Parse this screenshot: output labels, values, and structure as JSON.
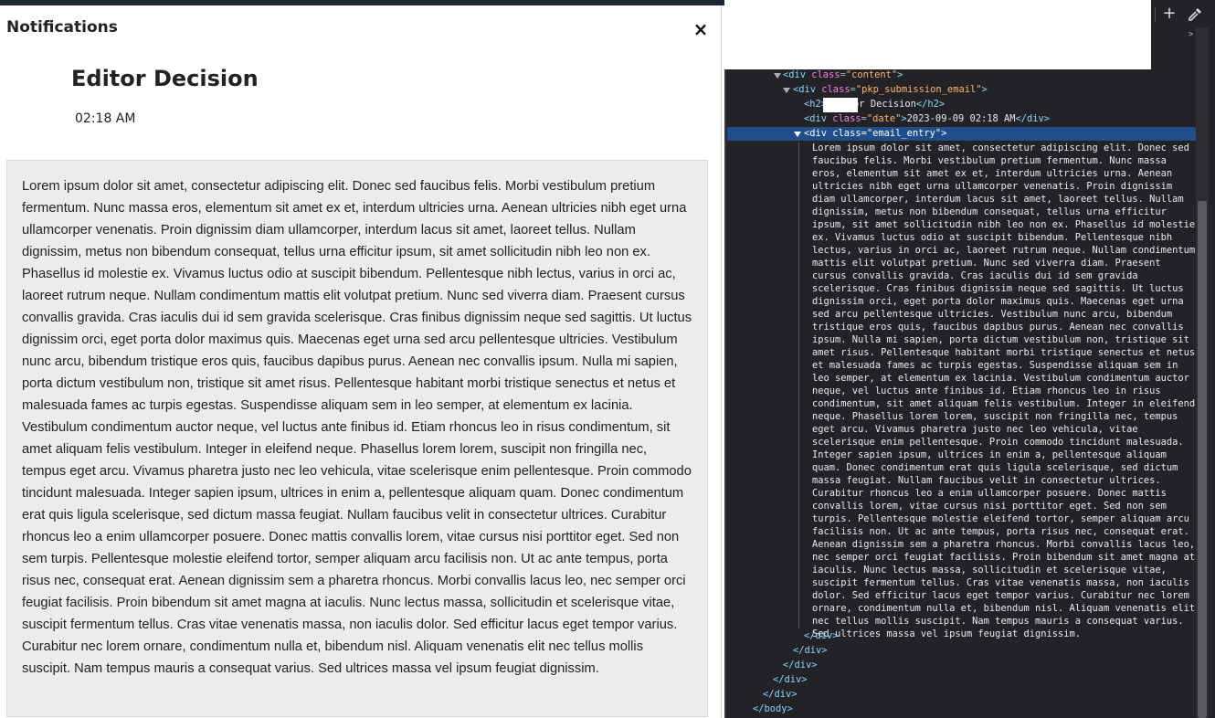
{
  "modal": {
    "title": "Notifications",
    "close_symbol": "×",
    "close_icon": "close-icon"
  },
  "notification": {
    "title": "Editor Decision",
    "time": "02:18 AM",
    "body": "Lorem ipsum dolor sit amet, consectetur adipiscing elit. Donec sed faucibus felis. Morbi vestibulum pretium fermentum. Nunc massa eros, elementum sit amet ex et, interdum ultricies urna. Aenean ultricies nibh eget urna ullamcorper venenatis. Proin dignissim diam ullamcorper, interdum lacus sit amet, laoreet tellus. Nullam dignissim, metus non bibendum consequat, tellus urna efficitur ipsum, sit amet sollicitudin nibh leo non ex. Phasellus id molestie ex. Vivamus luctus odio at suscipit bibendum. Pellentesque nibh lectus, varius in orci ac, laoreet rutrum neque. Nullam condimentum mattis elit volutpat pretium. Nunc sed viverra diam. Praesent cursus convallis gravida. Cras iaculis dui id sem gravida scelerisque. Cras finibus dignissim neque sed sagittis. Ut luctus dignissim orci, eget porta dolor maximus quis. Maecenas eget urna sed arcu pellentesque ultricies. Vestibulum nunc arcu, bibendum tristique eros quis, faucibus dapibus purus. Aenean nec convallis ipsum. Nulla mi sapien, porta dictum vestibulum non, tristique sit amet risus. Pellentesque habitant morbi tristique senectus et netus et malesuada fames ac turpis egestas. Suspendisse aliquam sem in leo semper, at elementum ex lacinia. Vestibulum condimentum auctor neque, vel luctus ante finibus id. Etiam rhoncus leo in risus condimentum, sit amet aliquam felis vestibulum. Integer in eleifend neque. Phasellus lorem lorem, suscipit non fringilla nec, tempus eget arcu. Vivamus pharetra justo nec leo vehicula, vitae scelerisque enim pellentesque. Proin commodo tincidunt malesuada. Integer sapien ipsum, ultrices in enim a, pellentesque aliquam quam. Donec condimentum erat quis ligula scelerisque, sed dictum massa feugiat. Nullam faucibus velit in consectetur ultrices. Curabitur rhoncus leo a enim ullamcorper posuere. Donec mattis convallis lorem, vitae cursus nisi porttitor eget. Sed non sem turpis. Pellentesque molestie eleifend tortor, semper aliquam arcu facilisis non. Ut ac ante tempus, porta risus nec, consequat erat. Aenean dignissim sem a pharetra rhoncus. Morbi convallis lacus leo, nec semper orci feugiat facilisis. Proin bibendum sit amet magna at iaculis. Nunc lectus massa, sollicitudin et scelerisque vitae, suscipit fermentum tellus. Cras vitae venenatis massa, non iaculis dolor. Sed efficitur lacus eget tempor varius. Curabitur nec lorem ornare, condimentum nulla et, bibendum nisl. Aliquam venenatis elit nec tellus mollis suscipit. Nam tempus mauris a consequat varius. Sed ultrices massa vel ipsum feugiat dignissim."
  },
  "devtools": {
    "toolbar": {
      "add_symbol": "+",
      "add_icon": "plus-icon",
      "picker_icon": "eyedropper-icon",
      "corner_glyph": ">"
    },
    "tree": {
      "content_div": {
        "open": "<div",
        "attr": "class",
        "eq": "=",
        "val": "\"content\"",
        "close": ">"
      },
      "submission_div": {
        "open": "<div",
        "attr": "class",
        "eq": "=",
        "val": "\"pkp_submission_email\"",
        "close": ">"
      },
      "h2": {
        "open": "<h2>",
        "text": "Editor Decision",
        "close": "</h2>"
      },
      "date_div": {
        "open": "<div",
        "attr": "class",
        "eq": "=",
        "val": "\"date\"",
        "close_open": ">",
        "text": "2023-09-09 02:18 AM",
        "close": "</div>"
      },
      "entry_div": {
        "open": "<div",
        "attr": "class",
        "eq": "=",
        "val": "\"email_entry\"",
        "close": ">"
      },
      "entry_text": "Lorem ipsum dolor sit amet, consectetur adipiscing elit. Donec sed faucibus felis. Morbi vestibulum pretium fermentum. Nunc massa eros, elementum sit amet ex et, interdum ultricies urna. Aenean ultricies nibh eget urna ullamcorper venenatis. Proin dignissim diam ullamcorper, interdum lacus sit amet, laoreet tellus. Nullam dignissim, metus non bibendum consequat, tellus urna efficitur ipsum, sit amet sollicitudin nibh leo non ex. Phasellus id molestie ex. Vivamus luctus odio at suscipit bibendum. Pellentesque nibh lectus, varius in orci ac, laoreet rutrum neque. Nullam condimentum mattis elit volutpat pretium. Nunc sed viverra diam. Praesent cursus convallis gravida. Cras iaculis dui id sem gravida scelerisque. Cras finibus dignissim neque sed sagittis. Ut luctus dignissim orci, eget porta dolor maximus quis. Maecenas eget urna sed arcu pellentesque ultricies. Vestibulum nunc arcu, bibendum tristique eros quis, faucibus dapibus purus. Aenean nec convallis ipsum. Nulla mi sapien, porta dictum vestibulum non, tristique sit amet risus. Pellentesque habitant morbi tristique senectus et netus et malesuada fames ac turpis egestas. Suspendisse aliquam sem in leo semper, at elementum ex lacinia. Vestibulum condimentum auctor neque, vel luctus ante finibus id. Etiam rhoncus leo in risus condimentum, sit amet aliquam felis vestibulum. Integer in eleifend neque. Phasellus lorem lorem, suscipit non fringilla nec, tempus eget arcu. Vivamus pharetra justo nec leo vehicula, vitae scelerisque enim pellentesque. Proin commodo tincidunt malesuada. Integer sapien ipsum, ultrices in enim a, pellentesque aliquam quam. Donec condimentum erat quis ligula scelerisque, sed dictum massa feugiat. Nullam faucibus velit in consectetur ultrices. Curabitur rhoncus leo a enim ullamcorper posuere. Donec mattis convallis lorem, vitae cursus nisi porttitor eget. Sed non sem turpis. Pellentesque molestie eleifend tortor, semper aliquam arcu facilisis non. Ut ac ante tempus, porta risus nec, consequat erat. Aenean dignissim sem a pharetra rhoncus. Morbi convallis lacus leo, nec semper orci feugiat facilisis. Proin bibendum sit amet magna at iaculis. Nunc lectus massa, sollicitudin et scelerisque vitae, suscipit fermentum tellus. Cras vitae venenatis massa, non iaculis dolor. Sed efficitur lacus eget tempor varius. Curabitur nec lorem ornare, condimentum nulla et, bibendum nisl. Aliquam venenatis elit nec tellus mollis suscipit. Nam tempus mauris a consequat varius. Sed ultrices massa vel ipsum feugiat dignissim.",
      "close_div": "</div>",
      "close_body": "</body>"
    },
    "colors": {
      "background": "#232327",
      "selection": "#204e8a",
      "tag": "#8bd4ff",
      "attribute": "#ff7de9",
      "value": "#ffb36b"
    }
  }
}
